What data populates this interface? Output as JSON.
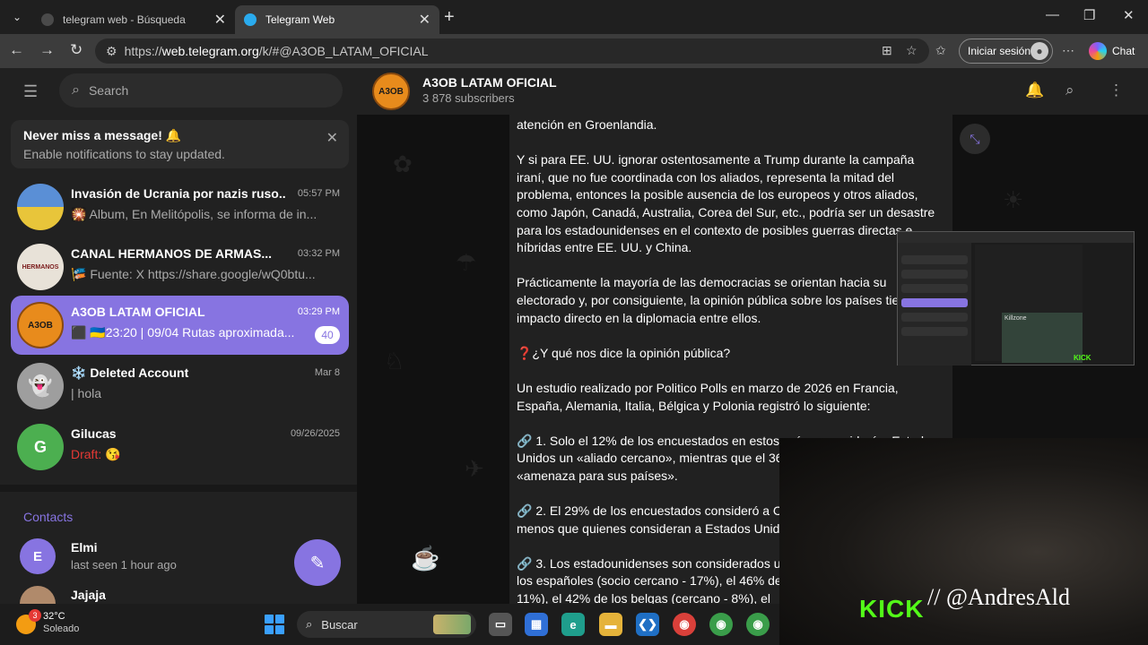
{
  "browser": {
    "tabs": [
      {
        "title": "telegram web - Búsqueda",
        "favicon_color": "#4a4a4a"
      },
      {
        "title": "Telegram Web",
        "favicon_color": "#2aabee"
      }
    ],
    "url_prefix": "https://",
    "url_host": "web.telegram.org",
    "url_path": "/k/#@A3OB_LATAM_OFICIAL",
    "signin_label": "Iniciar sesión",
    "chat_label": "Chat"
  },
  "sidebar": {
    "search_placeholder": "Search",
    "notice": {
      "title": "Never miss a message! 🔔",
      "subtitle": "Enable notifications to stay updated."
    },
    "chats": [
      {
        "name": "Invasión de Ucrania por nazis ruso...",
        "time": "05:57 PM",
        "preview": "🎇 Album, En Melitópolis, se informa de in...",
        "avatar_text": "",
        "avatar_color": "#5a8fd6"
      },
      {
        "name": "CANAL HERMANOS DE ARMAS...",
        "time": "03:32 PM",
        "preview": "🎏 Fuente: X https://share.google/wQ0btu...",
        "avatar_text": "HERMANOS",
        "avatar_color": "#e8e2d8"
      },
      {
        "name": "A3OB LATAM OFICIAL",
        "time": "03:29 PM",
        "preview": "⬛ 🇺🇦23:20 | 09/04 Rutas aproximada...",
        "avatar_text": "A3OB",
        "avatar_color": "#e88b1c",
        "unread": "40"
      },
      {
        "name": "❄️ Deleted Account",
        "time": "Mar 8",
        "preview": "| hola",
        "avatar_text": "👻",
        "avatar_color": "#9e9e9e"
      },
      {
        "name": "Gilucas",
        "time": "09/26/2025",
        "draft_label": "Draft:",
        "draft_text": "😘",
        "avatar_text": "G",
        "avatar_color": "#4caf50"
      }
    ],
    "contacts_header": "Contacts",
    "contacts": [
      {
        "name": "Elmi",
        "status": "last seen 1 hour ago",
        "avatar_text": "E",
        "avatar_color": "#8774e1"
      },
      {
        "name": "Jajaja",
        "status": "",
        "avatar_text": "",
        "avatar_color": "#b08a6b"
      }
    ]
  },
  "channel": {
    "name": "A3OB LATAM OFICIAL",
    "subscribers": "3 878 subscribers",
    "avatar_text": "A3OB",
    "message_paragraphs": [
      "atención en Groenlandia.",
      "Y si para EE. UU. ignorar ostentosamente a Trump durante la campaña iraní, que no fue coordinada con los aliados, representa la mitad del problema, entonces la posible ausencia de los europeos y otros aliados, como Japón, Canadá, Australia, Corea del Sur, etc., podría ser un desastre para los estadounidenses en el contexto de posibles guerras directas e híbridas entre EE. UU. y China.",
      "Prácticamente la mayoría de las democracias se orientan hacia su electorado y, por consiguiente, la opinión pública sobre los países tiene un impacto directo en la diplomacia entre ellos.",
      "❓¿Y qué nos dice la opinión pública?",
      "Un estudio realizado por Politico Polls en marzo de 2026 en Francia, España, Alemania, Italia, Bélgica y Polonia registró lo siguiente:",
      "🔗 1. Solo el 12% de los encuestados en estos países consideró a Estados Unidos un «aliado cercano», mientras que el 36% lo consideró una «amenaza para sus países».",
      "🔗 2. El 29% de los encuestados consideró a China un socio, apenas menos que quienes consideran a Estados Unidos.",
      "🔗 3. Los estadounidenses son considerados una amenaza por el 40% de los españoles (socio cercano - 17%), el 46% de los alemanes (cercano - 11%), el 42% de los belgas (cercano - 8%), el"
    ]
  },
  "stream_overlay": {
    "brand": "KICK",
    "handle": "// @AndresAld",
    "thumbnail_map_label": "Killzone"
  },
  "taskbar": {
    "temperature": "32°C",
    "condition": "Soleado",
    "weather_badge": "3",
    "search_label": "Buscar",
    "apps": [
      "task-view",
      "store",
      "edge",
      "explorer",
      "vscode",
      "chrome",
      "chrome-profile-a",
      "chrome-profile-b"
    ]
  },
  "colors": {
    "accent": "#8774e1",
    "kick_green": "#53fc18",
    "telegram_blue": "#2aabee"
  }
}
